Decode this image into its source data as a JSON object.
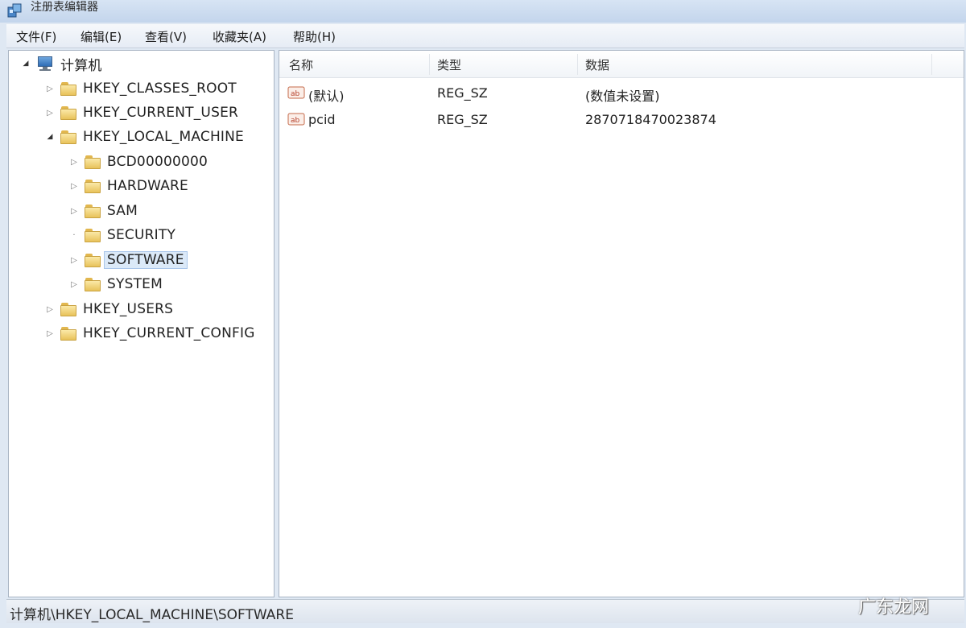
{
  "window": {
    "title": "注册表编辑器"
  },
  "menu": [
    "文件(F)",
    "编辑(E)",
    "查看(V)",
    "收藏夹(A)",
    "帮助(H)"
  ],
  "tree": {
    "root": "计算机",
    "items": [
      "HKEY_CLASSES_ROOT",
      "HKEY_CURRENT_USER",
      "HKEY_LOCAL_MACHINE",
      "BCD00000000",
      "HARDWARE",
      "SAM",
      "SECURITY",
      "SOFTWARE",
      "SYSTEM",
      "HKEY_USERS",
      "HKEY_CURRENT_CONFIG"
    ],
    "selected": "SOFTWARE"
  },
  "list": {
    "columns": [
      "名称",
      "类型",
      "数据"
    ],
    "rows": [
      {
        "name": "(默认)",
        "type": "REG_SZ",
        "data": "(数值未设置)"
      },
      {
        "name": "pcid",
        "type": "REG_SZ",
        "data": "2870718470023874"
      }
    ]
  },
  "status": {
    "path": "计算机\\HKEY_LOCAL_MACHINE\\SOFTWARE"
  },
  "watermark": "广东龙网",
  "colors": {
    "selection": "#dbe9f8",
    "folder": "#e8c25a"
  }
}
